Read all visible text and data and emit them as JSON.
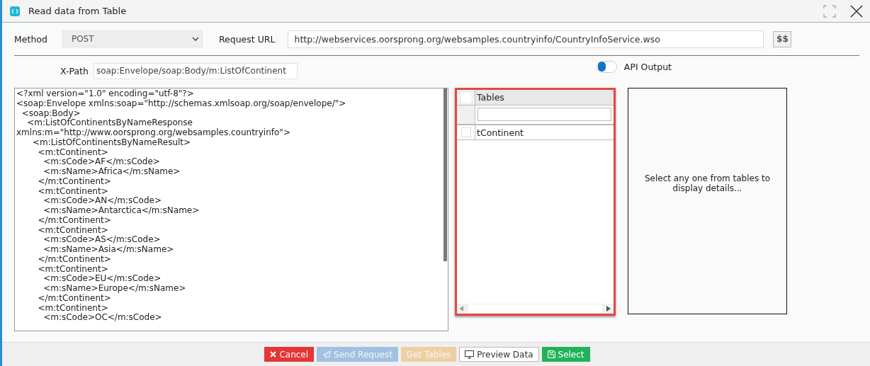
{
  "window": {
    "title": "Read data from Table"
  },
  "method": {
    "label": "Method",
    "value": "POST"
  },
  "request_url": {
    "label": "Request URL",
    "value": "http://webservices.oorsprong.org/websamples.countryinfo/CountryInfoService.wso",
    "button": "$$"
  },
  "xpath": {
    "label": "X-Path",
    "value": "soap:Envelope/soap:Body/m:ListOfContinent"
  },
  "api_output": {
    "label": "API Output",
    "on": false
  },
  "response_lines": [
    "<?xml version=\"1.0\" encoding=\"utf-8\"?>",
    "<soap:Envelope xmlns:soap=\"http://schemas.xmlsoap.org/soap/envelope/\">",
    "  <soap:Body>",
    "    <m:ListOfContinentsByNameResponse",
    "xmlns:m=\"http://www.oorsprong.org/websamples.countryinfo\">",
    "      <m:ListOfContinentsByNameResult>",
    "        <m:tContinent>",
    "          <m:sCode>AF</m:sCode>",
    "          <m:sName>Africa</m:sName>",
    "        </m:tContinent>",
    "        <m:tContinent>",
    "          <m:sCode>AN</m:sCode>",
    "          <m:sName>Antarctica</m:sName>",
    "        </m:tContinent>",
    "        <m:tContinent>",
    "          <m:sCode>AS</m:sCode>",
    "          <m:sName>Asia</m:sName>",
    "        </m:tContinent>",
    "        <m:tContinent>",
    "          <m:sCode>EU</m:sCode>",
    "          <m:sName>Europe</m:sName>",
    "        </m:tContinent>",
    "        <m:tContinent>",
    "          <m:sCode>OC</m:sCode>"
  ],
  "tables": {
    "header": "Tables",
    "header_checked": false,
    "rows": [
      {
        "name": "tContinent",
        "checked": false
      }
    ]
  },
  "details": {
    "message": "Select any one from tables to display details..."
  },
  "buttons": [
    {
      "label": "Cancel",
      "kind": "danger",
      "disabled": false
    },
    {
      "label": "Send Request",
      "kind": "primary",
      "disabled": true
    },
    {
      "label": "Get Tables",
      "kind": "warning",
      "disabled": true
    },
    {
      "label": "Preview Data",
      "kind": "default",
      "disabled": false
    },
    {
      "label": "Select",
      "kind": "success",
      "disabled": false
    }
  ]
}
